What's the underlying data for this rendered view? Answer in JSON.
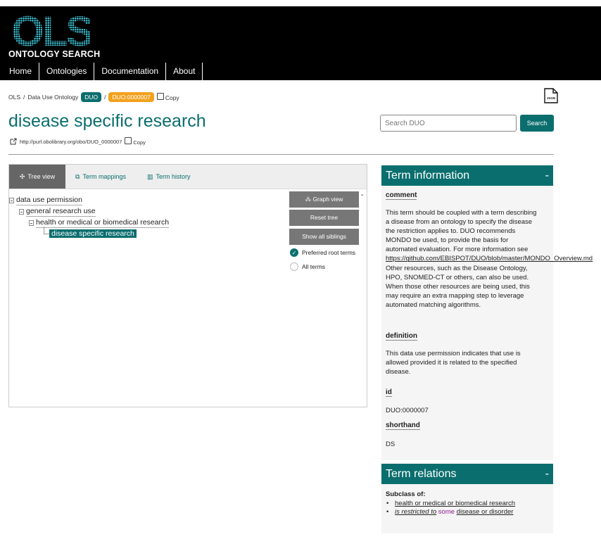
{
  "header": {
    "logo_text": "OLS",
    "subtitle": "ONTOLOGY SEARCH",
    "nav": [
      "Home",
      "Ontologies",
      "Documentation",
      "About"
    ]
  },
  "breadcrumb": {
    "root": "OLS",
    "ontology": "Data Use Ontology",
    "ontology_badge": "DUO",
    "term_badge": "DUO:0000007",
    "copy_label": "Copy",
    "json_label": "JSON"
  },
  "term": {
    "title": "disease specific research",
    "iri": "http://purl.obolibrary.org/obo/DUO_0000007",
    "copy_label": "Copy"
  },
  "search": {
    "placeholder": "Search DUO",
    "button": "Search"
  },
  "tabs": [
    {
      "label": "Tree view"
    },
    {
      "label": "Term mappings"
    },
    {
      "label": "Term history"
    }
  ],
  "tree": [
    {
      "label": "data use permission"
    },
    {
      "label": "general research use"
    },
    {
      "label": "health or medical or biomedical research"
    },
    {
      "label": "disease specific research"
    }
  ],
  "tree_controls": {
    "graph_view": "Graph view",
    "collapse": "-",
    "reset": "Reset tree",
    "siblings": "Show all siblings",
    "preferred": "Preferred root terms",
    "all": "All terms"
  },
  "info": {
    "heading": "Term information",
    "collapse": "-",
    "comment_label": "comment",
    "comment_lines": [
      "This term should be coupled with a term describing",
      "a disease from an ontology to specify the disease",
      "the restriction applies to. DUO recommends",
      "MONDO be used, to provide the basis for",
      "automated evaluation. For more information see",
      "https://github.com/EBISPOT/DUO/blob/master/MONDO_Overview.md",
      "Other resources, such as the Disease Ontology,",
      "HPO, SNOMED-CT or others, can also be used.",
      "When those other resources are being used, this",
      "may require an extra mapping step to leverage",
      "automated matching algorithms."
    ],
    "definition_label": "definition",
    "definition_lines": [
      "This data use permission indicates that use is",
      "allowed provided it is related to the specified",
      "disease."
    ],
    "id_label": "id",
    "id_value": "DUO:0000007",
    "shorthand_label": "shorthand",
    "shorthand_value": "DS"
  },
  "relations": {
    "heading": "Term relations",
    "collapse": "-",
    "subclass_label": "Subclass of:",
    "item1": "health or medical or biomedical research",
    "item2_prop": "is restricted to",
    "item2_some": "some",
    "item2_target": "disease or disorder"
  },
  "colors": {
    "accent": "#0b6e6e",
    "badge_orange": "#f2a11d",
    "topbar": "#000000"
  }
}
